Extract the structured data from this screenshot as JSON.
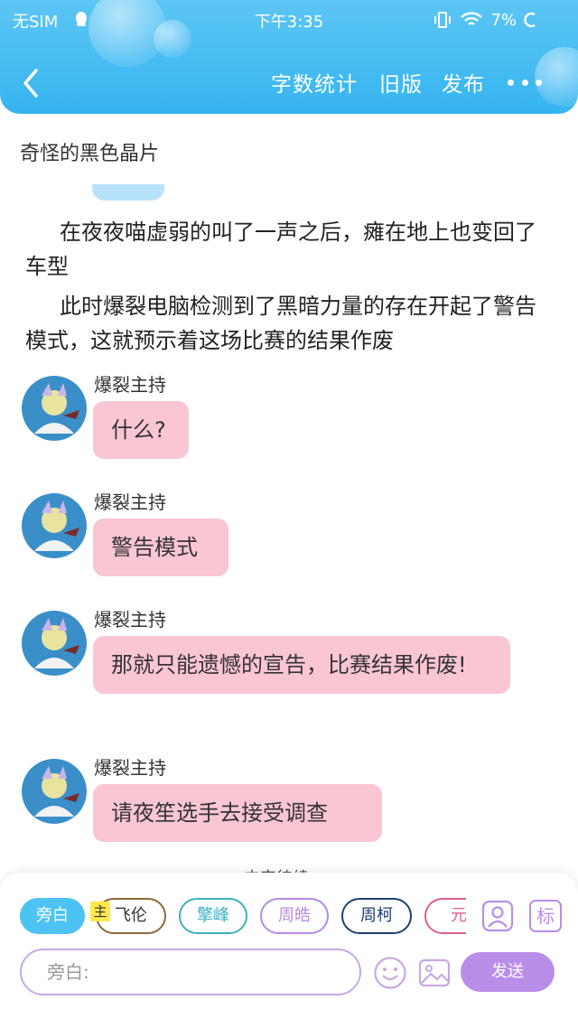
{
  "status_bar": {
    "carrier": "无SIM",
    "time": "下午3:35",
    "battery": "7%"
  },
  "header": {
    "word_count_label": "字数统计",
    "old_version_label": "旧版",
    "publish_label": "发布",
    "accent_color": "#36b4f0"
  },
  "story": {
    "title": "奇怪的黑色晶片",
    "paragraphs": [
      "在夜夜喵虚弱的叫了一声之后，瘫在地上也变回了车型",
      "此时爆裂电脑检测到了黑暗力量的存在开起了警告模式，这就预示着这场比赛的结果作废"
    ]
  },
  "messages": [
    {
      "speaker": "爆裂主持",
      "text": "什么?"
    },
    {
      "speaker": "爆裂主持",
      "text": "警告模式"
    },
    {
      "speaker": "爆裂主持",
      "text": "那就只能遗憾的宣告，比赛结果作废!"
    },
    {
      "speaker": "爆裂主持",
      "text": "请夜笙选手去接受调查"
    }
  ],
  "composer": {
    "peek_text": "未完待续",
    "roles": [
      "旁白",
      "飞伦",
      "擎峰",
      "周皓",
      "周柯",
      "元"
    ],
    "main_tag": "主",
    "input_placeholder": "旁白:",
    "send_label": "发送",
    "tag_icon_label": "标"
  }
}
